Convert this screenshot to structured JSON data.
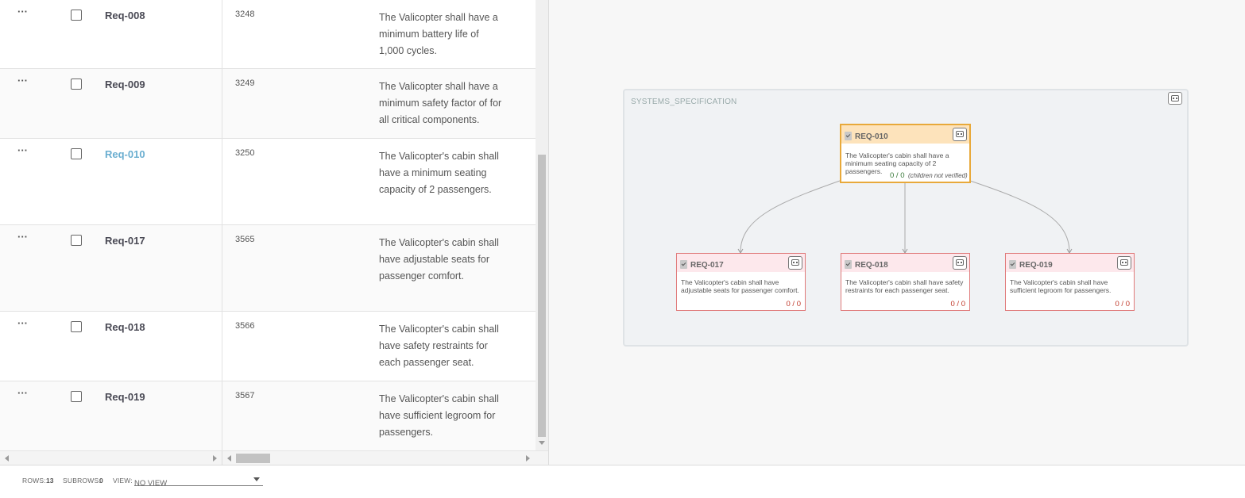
{
  "table": {
    "rows": [
      {
        "menu": "···",
        "id": "Req-008",
        "number": "3248",
        "description": "The Valicopter shall have a minimum battery life of 1,000 cycles."
      },
      {
        "menu": "···",
        "id": "Req-009",
        "number": "3249",
        "description": "The Valicopter shall have a minimum safety factor of for all critical components."
      },
      {
        "menu": "···",
        "id": "Req-010",
        "number": "3250",
        "description": "The Valicopter's cabin shall have a minimum seating capacity of 2 passengers."
      },
      {
        "menu": "···",
        "id": "Req-017",
        "number": "3565",
        "description": "The Valicopter's cabin shall have adjustable seats for passenger comfort."
      },
      {
        "menu": "···",
        "id": "Req-018",
        "number": "3566",
        "description": "The Valicopter's cabin shall have safety restraints for each passenger seat."
      },
      {
        "menu": "···",
        "id": "Req-019",
        "number": "3567",
        "description": "The Valicopter's cabin shall have sufficient legroom for passengers."
      }
    ]
  },
  "diagram": {
    "container_title": "SYSTEMS_SPECIFICATION",
    "root": {
      "id": "REQ-010",
      "text": "The Valicopter's cabin shall have a minimum seating capacity of 2 passengers.",
      "count": "0 / 0",
      "note": "(children not verified)"
    },
    "children": [
      {
        "id": "REQ-017",
        "text": "The Valicopter's cabin shall have adjustable seats for passenger comfort.",
        "count": "0 / 0"
      },
      {
        "id": "REQ-018",
        "text": "The Valicopter's cabin shall have safety restraints for each passenger seat.",
        "count": "0 / 0"
      },
      {
        "id": "REQ-019",
        "text": "The Valicopter's cabin shall have sufficient legroom for passengers.",
        "count": "0 / 0"
      }
    ]
  },
  "footer": {
    "rows_label": "ROWS:",
    "rows_value": "13",
    "subrows_label": "SUBROWS:",
    "subrows_value": "0",
    "view_label": "VIEW:",
    "view_value": "NO VIEW"
  },
  "colors": {
    "link": "#6aaed0",
    "selected_border": "#e8a93a",
    "child_border": "#e07a7a",
    "count_red": "#c0392b",
    "count_green": "#3a7a3a"
  }
}
